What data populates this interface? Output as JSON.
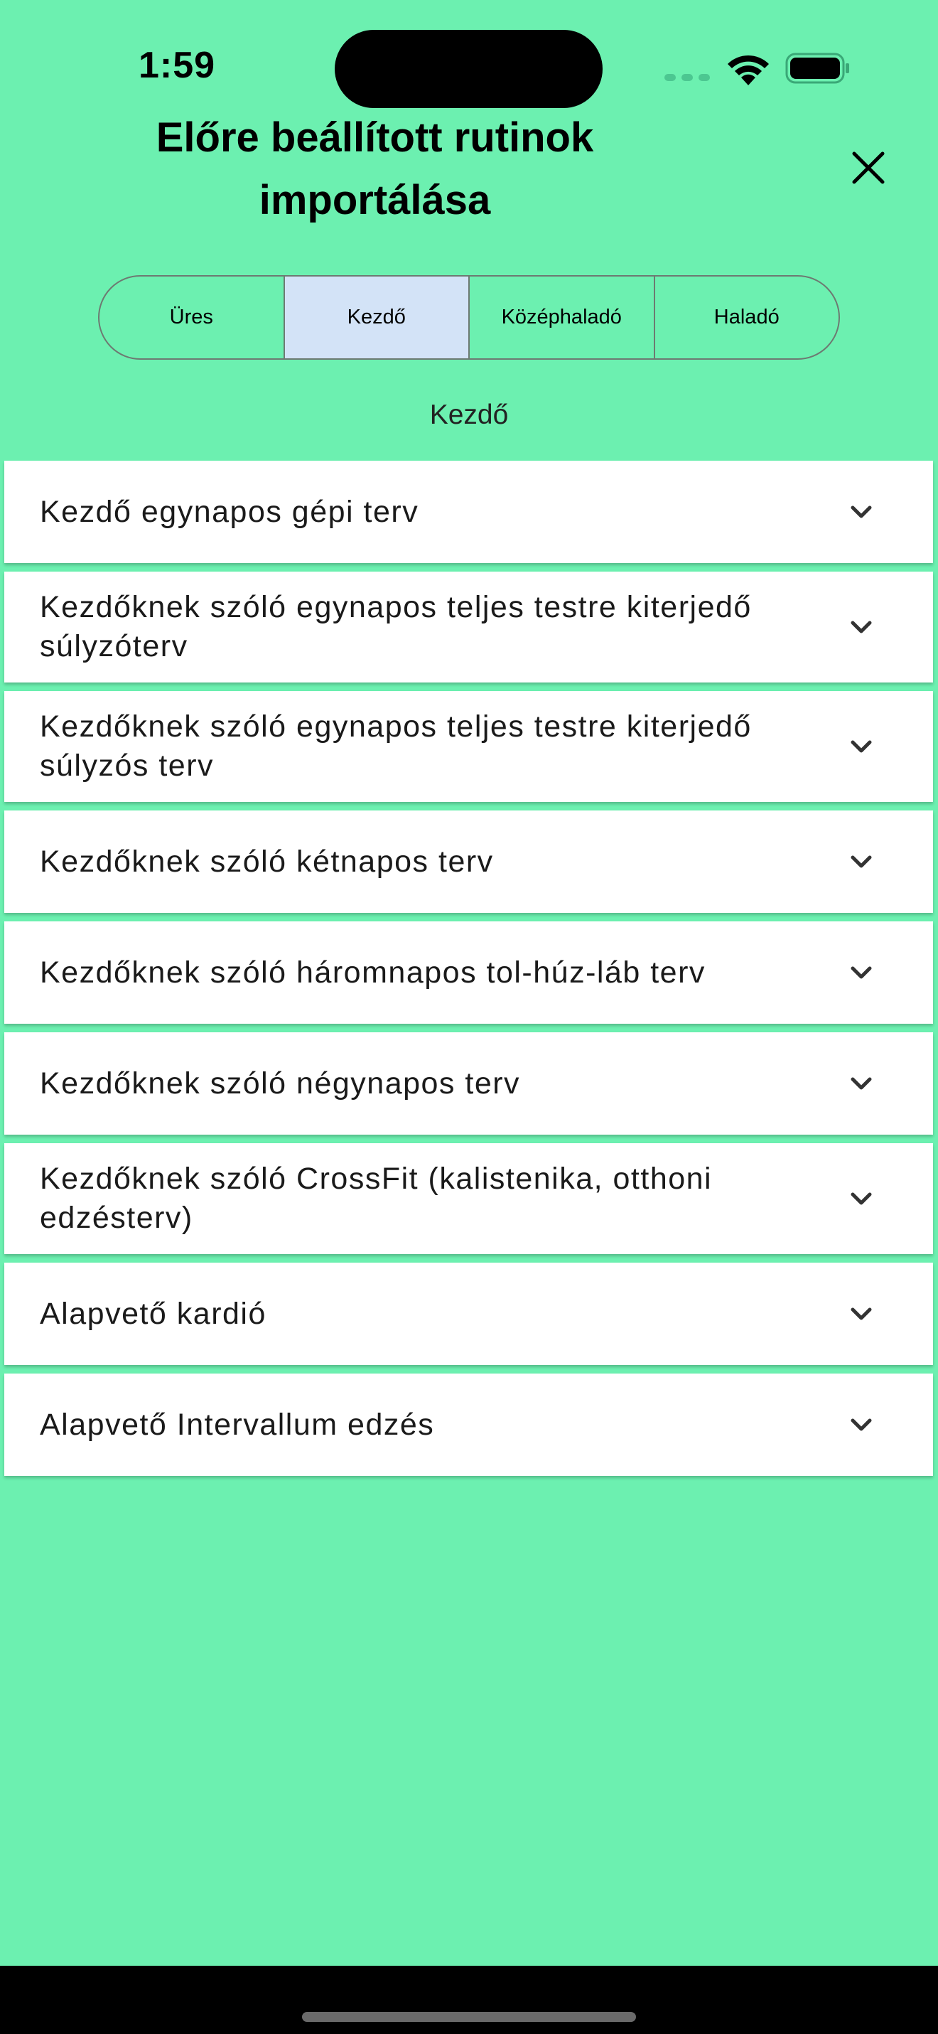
{
  "status_bar": {
    "time": "1:59"
  },
  "header": {
    "title": "Előre beállított rutinok importálása",
    "close_icon": "close-icon"
  },
  "tabs": [
    {
      "label": "Üres",
      "selected": false
    },
    {
      "label": "Kezdő",
      "selected": true
    },
    {
      "label": "Középhaladó",
      "selected": false
    },
    {
      "label": "Haladó",
      "selected": false
    }
  ],
  "section_label": "Kezdő",
  "routines": [
    {
      "label": "Kezdő egynapos gépi terv"
    },
    {
      "label": "Kezdőknek szóló egynapos teljes testre kiterjedő súlyzóterv"
    },
    {
      "label": "Kezdőknek szóló egynapos teljes testre kiterjedő súlyzós terv"
    },
    {
      "label": "Kezdőknek szóló kétnapos terv"
    },
    {
      "label": "Kezdőknek szóló háromnapos tol-húz-láb terv"
    },
    {
      "label": "Kezdőknek szóló négynapos terv"
    },
    {
      "label": "Kezdőknek szóló CrossFit (kalistenika, otthoni edzésterv)"
    },
    {
      "label": "Alapvető kardió"
    },
    {
      "label": "Alapvető Intervallum edzés"
    }
  ],
  "colors": {
    "background": "#6cf0b0",
    "selected_tab": "#d3e3f7",
    "card": "#ffffff"
  }
}
